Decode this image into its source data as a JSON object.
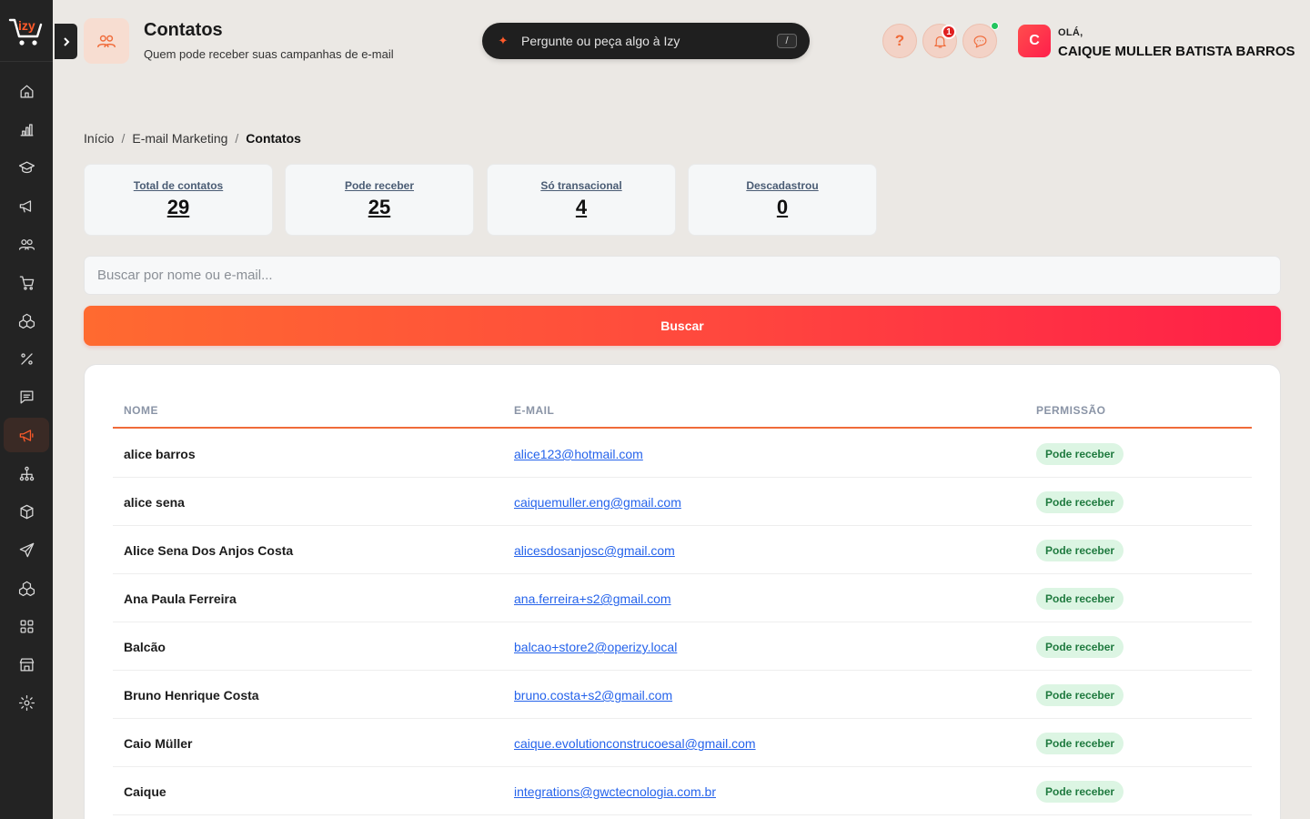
{
  "header": {
    "title": "Contatos",
    "subtitle": "Quem pode receber suas campanhas de e-mail",
    "ask_placeholder": "Pergunte ou peça algo à Izy",
    "ask_shortcut": "/",
    "notification_count": "1",
    "help_label": "?",
    "greeting": "OLÁ,",
    "username": "CAIQUE MULLER BATISTA BARROS",
    "avatar_initial": "C"
  },
  "brand": {
    "accent": "#f06b3a",
    "sidebar_bg": "#232323",
    "logo_text": "izy"
  },
  "sidebar": {
    "items": [
      {
        "icon": "home-icon"
      },
      {
        "icon": "chart-icon"
      },
      {
        "icon": "graduation-icon"
      },
      {
        "icon": "megaphone-icon"
      },
      {
        "icon": "users-icon"
      },
      {
        "icon": "cart-icon"
      },
      {
        "icon": "boxes-icon"
      },
      {
        "icon": "percent-icon"
      },
      {
        "icon": "message-icon"
      },
      {
        "icon": "campaign-icon",
        "active": true
      },
      {
        "icon": "network-icon"
      },
      {
        "icon": "package-icon"
      },
      {
        "icon": "send-icon"
      },
      {
        "icon": "stack-icon"
      },
      {
        "icon": "grid-icon"
      },
      {
        "icon": "store-icon"
      },
      {
        "icon": "settings-icon"
      }
    ]
  },
  "breadcrumb": {
    "home": "Início",
    "section": "E-mail Marketing",
    "current": "Contatos",
    "separator": "/"
  },
  "stats": [
    {
      "label": "Total de contatos",
      "value": "29"
    },
    {
      "label": "Pode receber",
      "value": "25"
    },
    {
      "label": "Só transacional",
      "value": "4"
    },
    {
      "label": "Descadastrou",
      "value": "0"
    }
  ],
  "search": {
    "placeholder": "Buscar por nome ou e-mail..."
  },
  "search_button": "Buscar",
  "table": {
    "columns": [
      "NOME",
      "E-MAIL",
      "PERMISSÃO"
    ],
    "rows": [
      {
        "name": "alice barros",
        "email": "alice123@hotmail.com",
        "permission": "Pode receber"
      },
      {
        "name": "alice sena",
        "email": "caiquemuller.eng@gmail.com",
        "permission": "Pode receber"
      },
      {
        "name": "Alice Sena Dos Anjos Costa",
        "email": "alicesdosanjosc@gmail.com",
        "permission": "Pode receber"
      },
      {
        "name": "Ana Paula Ferreira",
        "email": "ana.ferreira+s2@gmail.com",
        "permission": "Pode receber"
      },
      {
        "name": "Balcão",
        "email": "balcao+store2@operizy.local",
        "permission": "Pode receber"
      },
      {
        "name": "Bruno Henrique Costa",
        "email": "bruno.costa+s2@gmail.com",
        "permission": "Pode receber"
      },
      {
        "name": "Caio Müller",
        "email": "caique.evolutionconstrucoesal@gmail.com",
        "permission": "Pode receber"
      },
      {
        "name": "Caique",
        "email": "integrations@gwctecnologia.com.br",
        "permission": "Pode receber"
      }
    ]
  }
}
